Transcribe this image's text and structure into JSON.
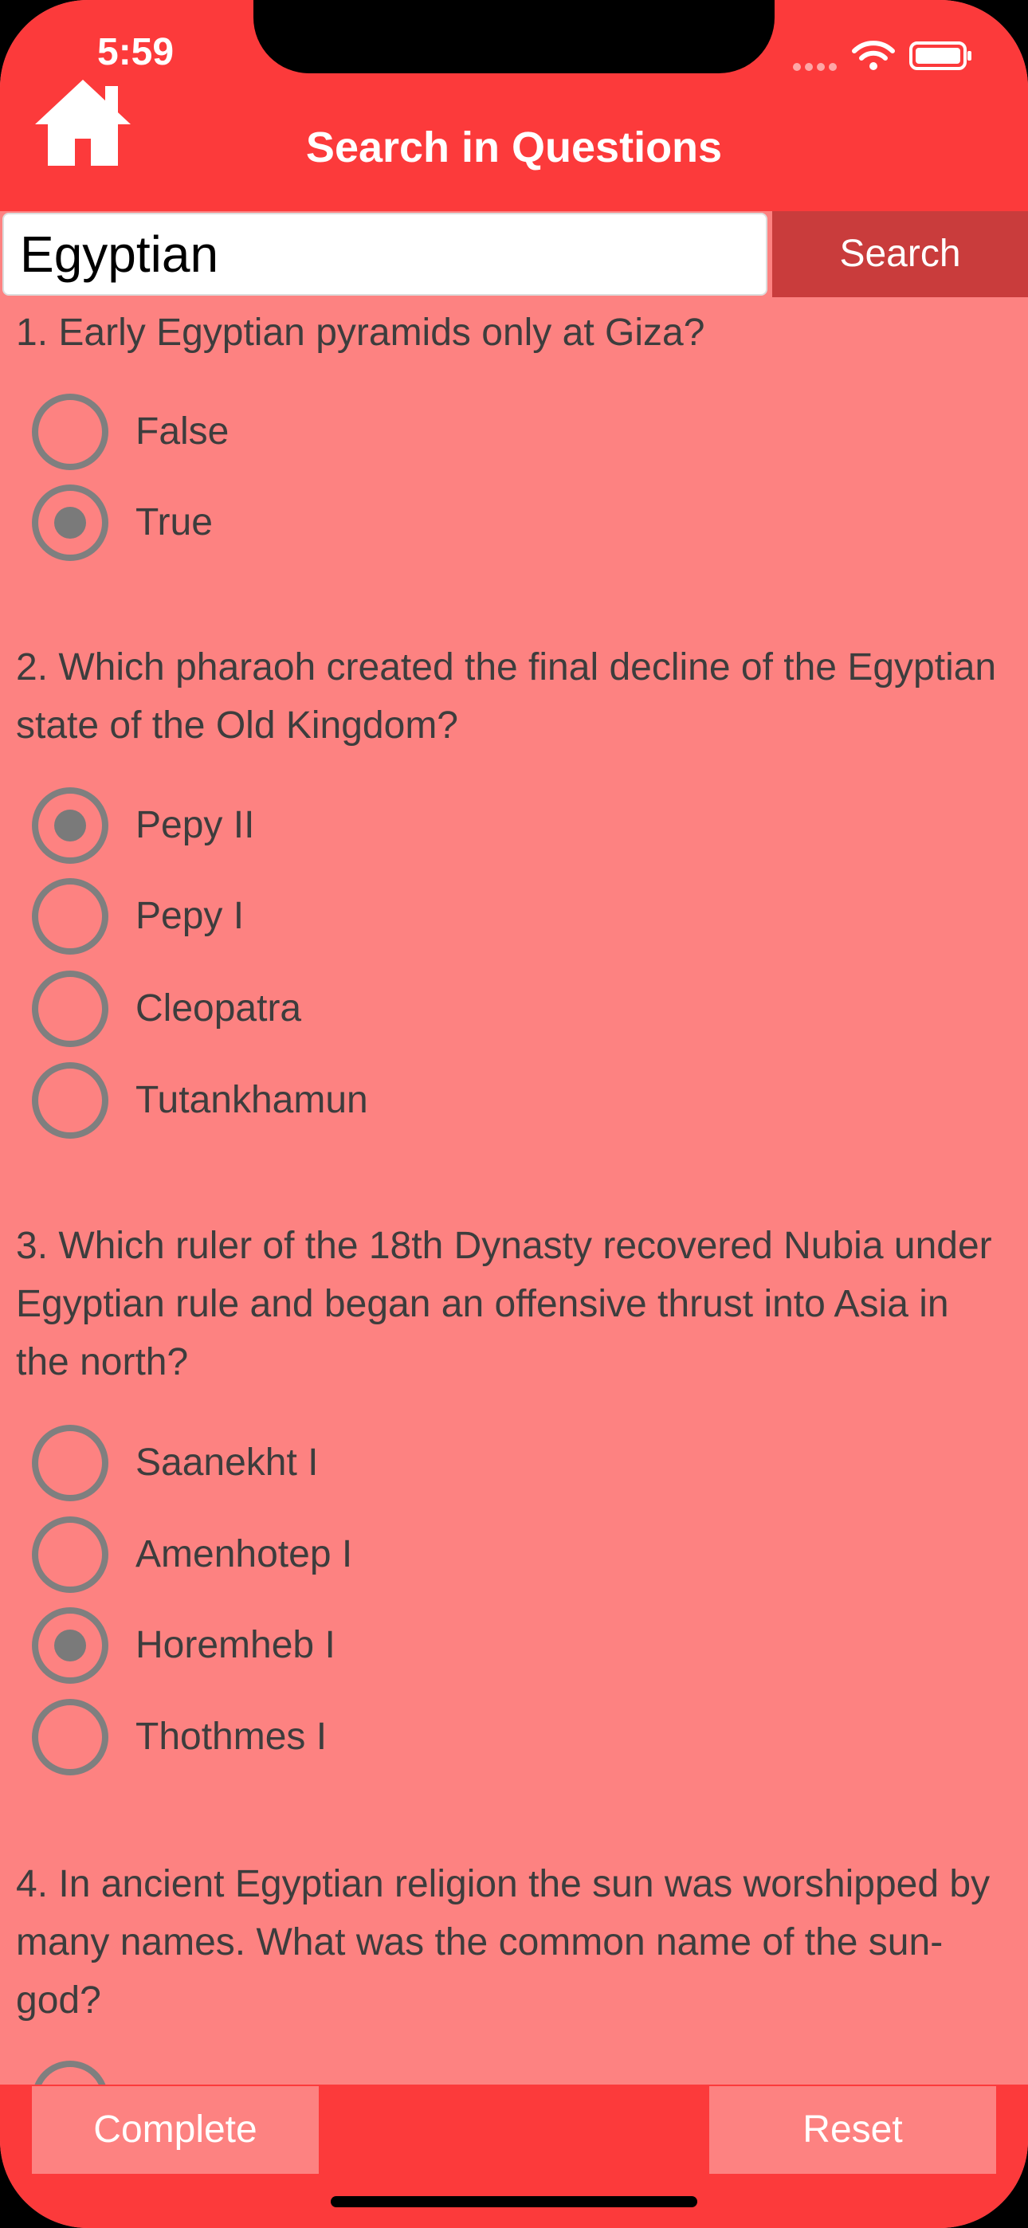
{
  "status": {
    "time": "5:59"
  },
  "colors": {
    "accent": "#fc3a3b",
    "content_bg": "#fd8281",
    "search_button": "#c93c3c"
  },
  "header": {
    "title": "Search in Questions",
    "home_icon": "home-icon"
  },
  "search": {
    "value": "Egyptian",
    "button_label": "Search"
  },
  "questions": [
    {
      "text": "1. Early Egyptian pyramids only at Giza?",
      "options": [
        {
          "label": "False",
          "selected": false
        },
        {
          "label": "True",
          "selected": true
        }
      ]
    },
    {
      "text": "2. Which pharaoh created the final decline of the Egyptian state of the Old Kingdom?",
      "options": [
        {
          "label": "Pepy II",
          "selected": true
        },
        {
          "label": "Pepy I",
          "selected": false
        },
        {
          "label": "Cleopatra",
          "selected": false
        },
        {
          "label": "Tutankhamun",
          "selected": false
        }
      ]
    },
    {
      "text": "3. Which ruler of the 18th Dynasty recovered Nubia under Egyptian rule and began an offensive thrust into Asia in the north?",
      "options": [
        {
          "label": "Saanekht I",
          "selected": false
        },
        {
          "label": "Amenhotep I",
          "selected": false
        },
        {
          "label": "Horemheb I",
          "selected": true
        },
        {
          "label": "Thothmes I",
          "selected": false
        }
      ]
    },
    {
      "text": "4. In ancient Egyptian religion the sun was worshipped by many names. What was the common name of the sun-god?",
      "options": []
    }
  ],
  "footer": {
    "complete_label": "Complete",
    "reset_label": "Reset"
  }
}
